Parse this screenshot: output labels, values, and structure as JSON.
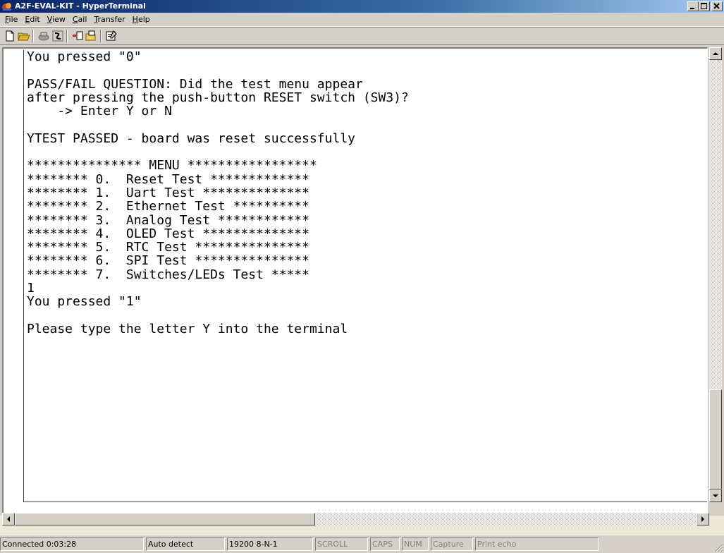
{
  "window": {
    "title": "A2F-EVAL-KIT - HyperTerminal",
    "caption_buttons": [
      "minimize",
      "maximize",
      "close"
    ]
  },
  "menu": [
    {
      "label": "File",
      "key": "F"
    },
    {
      "label": "Edit",
      "key": "E"
    },
    {
      "label": "View",
      "key": "V"
    },
    {
      "label": "Call",
      "key": "C"
    },
    {
      "label": "Transfer",
      "key": "T"
    },
    {
      "label": "Help",
      "key": "H"
    }
  ],
  "toolbar": {
    "icons": [
      "new-icon",
      "open-icon",
      "disconnect-icon",
      "dial-icon",
      "send-icon",
      "receive-icon",
      "properties-icon"
    ]
  },
  "terminal": {
    "lines": [
      "You pressed \"0\"",
      "",
      "PASS/FAIL QUESTION: Did the test menu appear",
      "after pressing the push-button RESET switch (SW3)?",
      "    -> Enter Y or N",
      "",
      "YTEST PASSED - board was reset successfully",
      "",
      "*************** MENU *****************",
      "******** 0.  Reset Test *************",
      "******** 1.  Uart Test **************",
      "******** 2.  Ethernet Test **********",
      "******** 3.  Analog Test ************",
      "******** 4.  OLED Test **************",
      "******** 5.  RTC Test ***************",
      "******** 6.  SPI Test ***************",
      "******** 7.  Switches/LEDs Test *****",
      "1",
      "You pressed \"1\"",
      "",
      "Please type the letter Y into the terminal"
    ]
  },
  "statusbar": {
    "connected": "Connected 0:03:28",
    "detect": "Auto detect",
    "settings": "19200 8-N-1",
    "scroll": "SCROLL",
    "caps": "CAPS",
    "num": "NUM",
    "capture": "Capture",
    "print_echo": "Print echo"
  },
  "colors": {
    "title_start": "#0a246a",
    "title_end": "#a6caf0",
    "face": "#d4d0c8",
    "terminal_bg": "#ffffff"
  }
}
